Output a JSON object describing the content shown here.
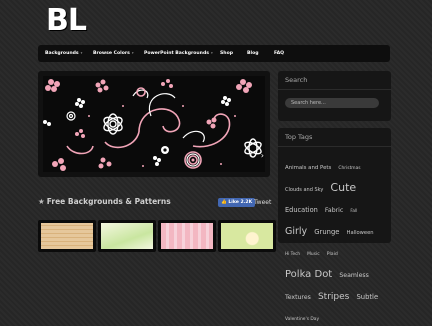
{
  "logo": {
    "text": "BL"
  },
  "nav": {
    "items": [
      {
        "label": "Backgrounds",
        "has_menu": true
      },
      {
        "label": "Browse Colors",
        "has_menu": true
      },
      {
        "label": "PowerPoint Backgrounds",
        "has_menu": true
      },
      {
        "label": "Shop",
        "has_menu": false
      },
      {
        "label": "Blog",
        "has_menu": false
      },
      {
        "label": "FAQ",
        "has_menu": false
      }
    ]
  },
  "slider": {
    "prev": "‹",
    "next": "›"
  },
  "main": {
    "section_title": "Free Backgrounds & Patterns",
    "like_label": "Like 2.2K",
    "tweet_label": "Tweet"
  },
  "sidebar": {
    "search": {
      "title": "Search",
      "placeholder": "Search here..."
    },
    "tags": {
      "title": "Top Tags",
      "items": [
        {
          "label": "Animals and Pets",
          "size": 5.4
        },
        {
          "label": "Christmas",
          "size": 4.4
        },
        {
          "label": "Clouds and Sky",
          "size": 5.0
        },
        {
          "label": "Cute",
          "size": 11
        },
        {
          "label": "Education",
          "size": 6.6
        },
        {
          "label": "Fabric",
          "size": 6.2
        },
        {
          "label": "Fall",
          "size": 4.2
        },
        {
          "label": "Girly",
          "size": 9.5
        },
        {
          "label": "Grunge",
          "size": 6.8
        },
        {
          "label": "Halloween",
          "size": 5.2
        },
        {
          "label": "Hi Tech",
          "size": 4.2
        },
        {
          "label": "Music",
          "size": 4.4
        },
        {
          "label": "Plaid",
          "size": 4.6
        },
        {
          "label": "Polka Dot",
          "size": 10
        },
        {
          "label": "Seamless",
          "size": 6.2
        },
        {
          "label": "Textures",
          "size": 6.2
        },
        {
          "label": "Stripes",
          "size": 9
        },
        {
          "label": "Subtle",
          "size": 6.8
        },
        {
          "label": "Valentine's Day",
          "size": 4.4
        }
      ]
    }
  },
  "thumbnails": [
    {
      "name": "thumb-1",
      "color": "#e6c79b"
    },
    {
      "name": "thumb-2",
      "color": "#f4f7e0"
    },
    {
      "name": "thumb-3",
      "color": "#f3b7c2"
    },
    {
      "name": "thumb-4",
      "color": "#d8e8a0"
    }
  ]
}
